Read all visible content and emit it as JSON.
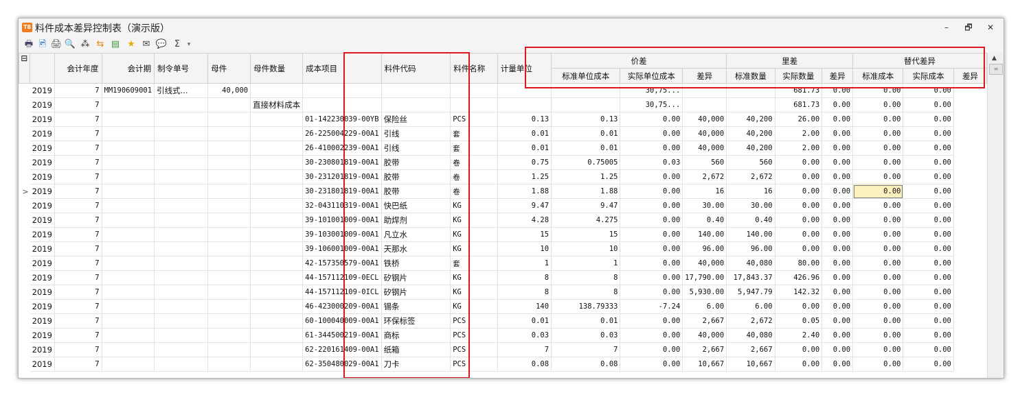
{
  "window": {
    "title": "料件成本差异控制表（演示版）",
    "app_badge": "T8",
    "minimize": "–",
    "restore": "🗗",
    "close": "✕"
  },
  "toolbar": [
    "page-setup-icon",
    "preview-icon",
    "print-icon",
    "filter-icon",
    "find-icon",
    "refresh-icon",
    "export-icon",
    "favorite-icon",
    "mail-icon",
    "comment-icon",
    "sum-icon",
    "more-dropdown-icon"
  ],
  "toolbar_glyphs": [
    "🖶",
    "🖻",
    "🖨",
    "🔍",
    "⁂",
    "⇆",
    "▤",
    "★",
    "✉",
    "💬",
    "Σ",
    "▾"
  ],
  "grid": {
    "collapse_glyph": "⊟",
    "headers": [
      "会计年度",
      "会计期",
      "制令单号",
      "母件",
      "母件数量",
      "成本项目",
      "料件代码",
      "料件名称",
      "计量单位"
    ],
    "groups": [
      "价差",
      "里差",
      "替代差异"
    ],
    "subheaders": [
      "标准单位成本",
      "实际单位成本",
      "差异",
      "标准数量",
      "实际数量",
      "差异",
      "标准成本",
      "实际成本",
      "差异"
    ],
    "row_marker": ">",
    "rows": [
      [
        "2019",
        "7",
        "MM190609001",
        "引线式...",
        "40,000",
        "",
        "",
        "",
        "",
        "",
        "",
        "30,75...",
        "",
        "",
        "681.73",
        "0.00",
        "0.00",
        "0.00"
      ],
      [
        "2019",
        "7",
        "",
        "",
        "",
        "直接材料成本",
        "",
        "",
        "",
        "",
        "",
        "30,75...",
        "",
        "",
        "681.73",
        "0.00",
        "0.00",
        "0.00"
      ],
      [
        "2019",
        "7",
        "",
        "",
        "",
        "",
        "01-142230039-00YB",
        "保险丝",
        "PCS",
        "0.13",
        "0.13",
        "0.00",
        "40,000",
        "40,200",
        "26.00",
        "0.00",
        "0.00",
        "0.00"
      ],
      [
        "2019",
        "7",
        "",
        "",
        "",
        "",
        "26-225004229-00A1",
        "引线",
        "套",
        "0.01",
        "0.01",
        "0.00",
        "40,000",
        "40,200",
        "2.00",
        "0.00",
        "0.00",
        "0.00"
      ],
      [
        "2019",
        "7",
        "",
        "",
        "",
        "",
        "26-410002239-00A1",
        "引线",
        "套",
        "0.01",
        "0.01",
        "0.00",
        "40,000",
        "40,200",
        "2.00",
        "0.00",
        "0.00",
        "0.00"
      ],
      [
        "2019",
        "7",
        "",
        "",
        "",
        "",
        "30-230801819-00A1",
        "胶带",
        "卷",
        "0.75",
        "0.75005",
        "0.03",
        "560",
        "560",
        "0.00",
        "0.00",
        "0.00",
        "0.00"
      ],
      [
        "2019",
        "7",
        "",
        "",
        "",
        "",
        "30-231201819-00A1",
        "胶带",
        "卷",
        "1.25",
        "1.25",
        "0.00",
        "2,672",
        "2,672",
        "0.00",
        "0.00",
        "0.00",
        "0.00"
      ],
      [
        "2019",
        "7",
        "",
        "",
        "",
        "",
        "30-231801819-00A1",
        "胶带",
        "卷",
        "1.88",
        "1.88",
        "0.00",
        "16",
        "16",
        "0.00",
        "0.00",
        "0.00",
        "0.00"
      ],
      [
        "2019",
        "7",
        "",
        "",
        "",
        "",
        "32-043110319-00A1",
        "快巴纸",
        "KG",
        "9.47",
        "9.47",
        "0.00",
        "30.00",
        "30.00",
        "0.00",
        "0.00",
        "0.00",
        "0.00"
      ],
      [
        "2019",
        "7",
        "",
        "",
        "",
        "",
        "39-101001009-00A1",
        "助焊剂",
        "KG",
        "4.28",
        "4.275",
        "0.00",
        "0.40",
        "0.40",
        "0.00",
        "0.00",
        "0.00",
        "0.00"
      ],
      [
        "2019",
        "7",
        "",
        "",
        "",
        "",
        "39-103001009-00A1",
        "凡立水",
        "KG",
        "15",
        "15",
        "0.00",
        "140.00",
        "140.00",
        "0.00",
        "0.00",
        "0.00",
        "0.00"
      ],
      [
        "2019",
        "7",
        "",
        "",
        "",
        "",
        "39-106001009-00A1",
        "天那水",
        "KG",
        "10",
        "10",
        "0.00",
        "96.00",
        "96.00",
        "0.00",
        "0.00",
        "0.00",
        "0.00"
      ],
      [
        "2019",
        "7",
        "",
        "",
        "",
        "",
        "42-157350579-00A1",
        "铁桥",
        "套",
        "1",
        "1",
        "0.00",
        "40,000",
        "40,080",
        "80.00",
        "0.00",
        "0.00",
        "0.00"
      ],
      [
        "2019",
        "7",
        "",
        "",
        "",
        "",
        "44-157112109-0ECL",
        "矽钢片",
        "KG",
        "8",
        "8",
        "0.00",
        "17,790.00",
        "17,843.37",
        "426.96",
        "0.00",
        "0.00",
        "0.00"
      ],
      [
        "2019",
        "7",
        "",
        "",
        "",
        "",
        "44-157112109-0ICL",
        "矽钢片",
        "KG",
        "8",
        "8",
        "0.00",
        "5,930.00",
        "5,947.79",
        "142.32",
        "0.00",
        "0.00",
        "0.00"
      ],
      [
        "2019",
        "7",
        "",
        "",
        "",
        "",
        "46-423000209-00A1",
        "锡条",
        "KG",
        "140",
        "138.79333",
        "-7.24",
        "6.00",
        "6.00",
        "0.00",
        "0.00",
        "0.00",
        "0.00"
      ],
      [
        "2019",
        "7",
        "",
        "",
        "",
        "",
        "60-100040009-00A1",
        "环保标签",
        "PCS",
        "0.01",
        "0.01",
        "0.00",
        "2,667",
        "2,672",
        "0.05",
        "0.00",
        "0.00",
        "0.00"
      ],
      [
        "2019",
        "7",
        "",
        "",
        "",
        "",
        "61-344500219-00A1",
        "商标",
        "PCS",
        "0.03",
        "0.03",
        "0.00",
        "40,000",
        "40,080",
        "2.40",
        "0.00",
        "0.00",
        "0.00"
      ],
      [
        "2019",
        "7",
        "",
        "",
        "",
        "",
        "62-220161409-00A1",
        "纸箱",
        "PCS",
        "7",
        "7",
        "0.00",
        "2,667",
        "2,667",
        "0.00",
        "0.00",
        "0.00",
        "0.00"
      ],
      [
        "2019",
        "7",
        "",
        "",
        "",
        "",
        "62-350480029-00A1",
        "刀卡",
        "PCS",
        "0.08",
        "0.08",
        "0.00",
        "10,667",
        "10,667",
        "0.00",
        "0.00",
        "0.00",
        "0.00"
      ]
    ]
  }
}
